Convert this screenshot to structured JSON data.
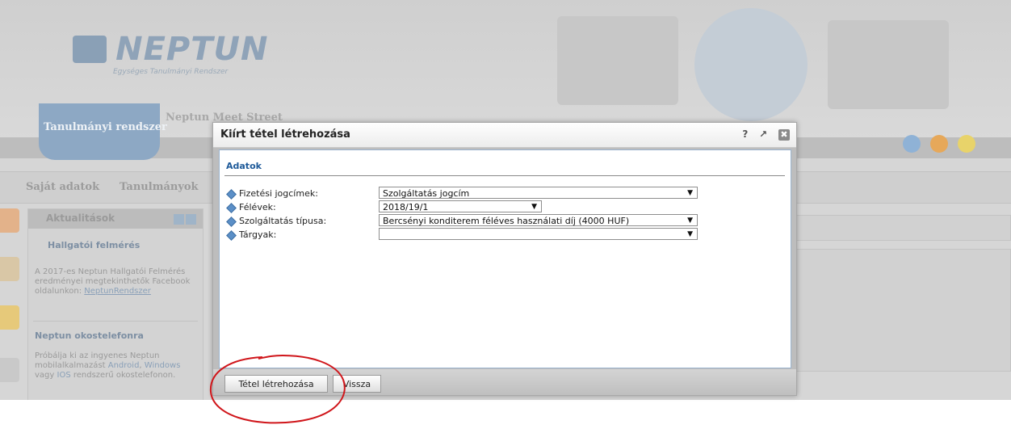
{
  "header": {
    "logo_word": "NEPTUN",
    "logo_sub": "Egységes Tanulmányi Rendszer",
    "tabs": [
      {
        "label": "Tanulmányi rendszer"
      },
      {
        "label": "Neptun Meet Street"
      }
    ]
  },
  "menu": {
    "items": [
      {
        "label": "Saját adatok"
      },
      {
        "label": "Tanulmányok"
      }
    ]
  },
  "news": {
    "title": "Aktualitások",
    "items": [
      {
        "title": "Hallgatói felmérés",
        "text": "A 2017-es Neptun Hallgatói Felmérés eredményei megtekinthetők Facebook oldalunkon: ",
        "link": "NeptunRendszer"
      },
      {
        "title": "Neptun okostelefonra",
        "text_a": "Próbálja ki az ingyenes Neptun mobilalkalmazást ",
        "android": "Android",
        "text_b": ", ",
        "windows": "Windows",
        "text_c": " vagy ",
        "ios": "IOS",
        "text_d": " rendszerű okostelefonon."
      }
    ]
  },
  "dialog": {
    "title": "Kiírt tétel létrehozása",
    "help": "?",
    "section_title": "Adatok",
    "fields": [
      {
        "label": "Fizetési jogcímek:",
        "value": "Szolgáltatás jogcím"
      },
      {
        "label": "Félévek:",
        "value": "2018/19/1"
      },
      {
        "label": "Szolgáltatás típusa:",
        "value": "Bercsényi konditerem féléves használati díj (4000 HUF)"
      },
      {
        "label": "Tárgyak:",
        "value": ""
      }
    ],
    "buttons": {
      "create": "Tétel létrehozása",
      "back": "Vissza"
    }
  },
  "colors": {
    "accent": "#1e5a99",
    "annotation": "#d0161b"
  }
}
